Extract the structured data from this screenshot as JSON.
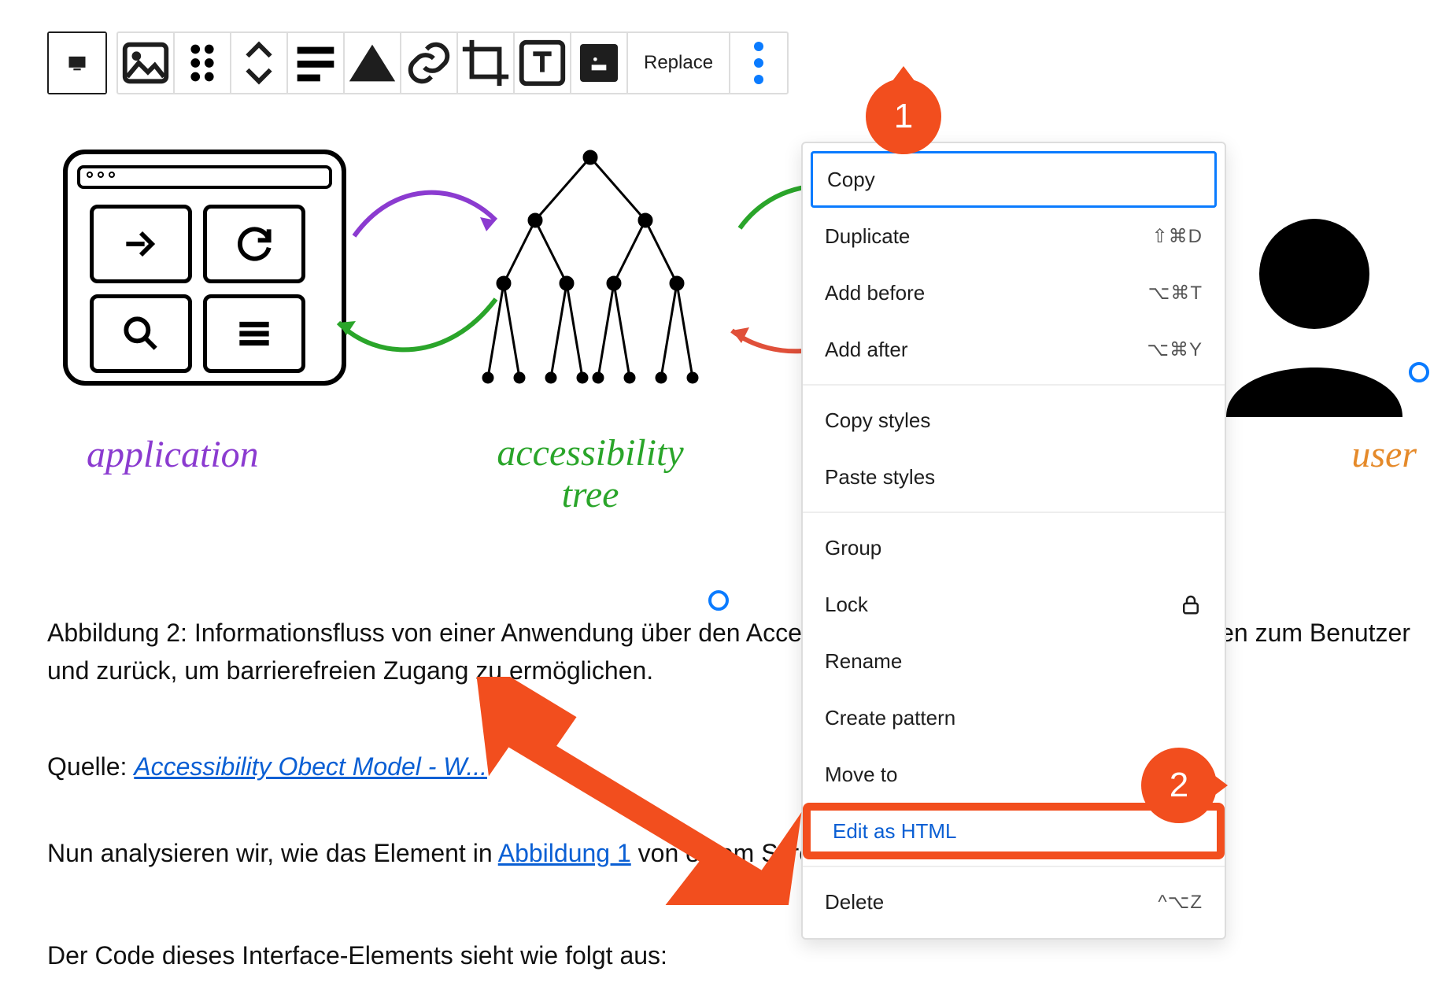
{
  "toolbar": {
    "replace_label": "Replace"
  },
  "figure": {
    "label_application": "application",
    "label_tree_line1": "accessibility",
    "label_tree_line2": "tree",
    "label_user": "user"
  },
  "caption": "Abbildung 2: Informationsfluss von einer Anwendung über den Accessibility Tree und assistive Technologien zum Benutzer und zurück, um barrierefreien Zugang zu ermöglichen.",
  "source_prefix": "Quelle: ",
  "source_link": "Accessibility Obect Model - W...",
  "para1_pre": "Nun analysieren wir, wie das Element in ",
  "para1_link": "Abbildung 1",
  "para1_post": " von einem Screenreader vorgelesen wird.",
  "para2": "Der Code dieses Interface-Elements sieht wie folgt aus:",
  "menu": {
    "copy": {
      "label": "Copy",
      "kbd": ""
    },
    "duplicate": {
      "label": "Duplicate",
      "kbd": "⇧⌘D"
    },
    "add_before": {
      "label": "Add before",
      "kbd": "⌥⌘T"
    },
    "add_after": {
      "label": "Add after",
      "kbd": "⌥⌘Y"
    },
    "copy_styles": {
      "label": "Copy styles",
      "kbd": ""
    },
    "paste_styles": {
      "label": "Paste styles",
      "kbd": ""
    },
    "group": {
      "label": "Group",
      "kbd": ""
    },
    "lock": {
      "label": "Lock",
      "kbd": ""
    },
    "rename": {
      "label": "Rename",
      "kbd": ""
    },
    "create_pattern": {
      "label": "Create pattern",
      "kbd": ""
    },
    "move_to": {
      "label": "Move to",
      "kbd": ""
    },
    "edit_html": {
      "label": "Edit as HTML",
      "kbd": ""
    },
    "delete": {
      "label": "Delete",
      "kbd": "^⌥Z"
    }
  },
  "annotations": {
    "badge1": "1",
    "badge2": "2"
  }
}
